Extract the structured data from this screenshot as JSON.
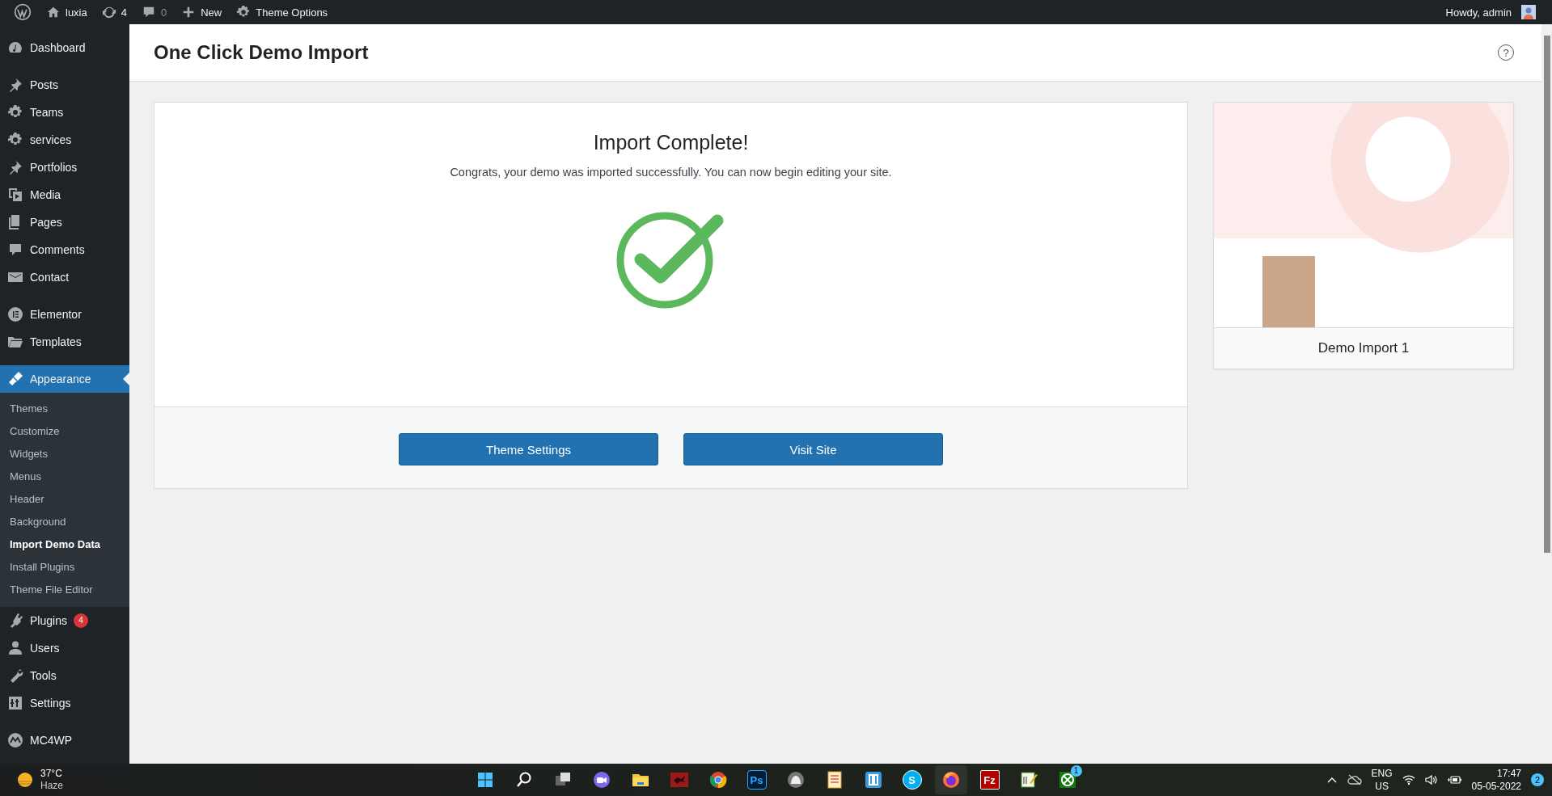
{
  "admin_bar": {
    "items": [
      {
        "kind": "wp-logo"
      },
      {
        "kind": "home",
        "label": "luxia"
      },
      {
        "kind": "updates",
        "label": "4"
      },
      {
        "kind": "comments",
        "label": "0",
        "disabled": true
      },
      {
        "kind": "new",
        "label": "New"
      },
      {
        "kind": "gear",
        "label": "Theme Options"
      }
    ],
    "greeting": "Howdy, admin"
  },
  "sidebar": {
    "items": [
      {
        "kind": "dashboard",
        "label": "Dashboard",
        "selected": false,
        "separator_after": true
      },
      {
        "kind": "pin",
        "label": "Posts",
        "selected": false
      },
      {
        "kind": "gear",
        "label": "Teams",
        "selected": false
      },
      {
        "kind": "gear",
        "label": "services",
        "selected": false
      },
      {
        "kind": "pin",
        "label": "Portfolios",
        "selected": false
      },
      {
        "kind": "media",
        "label": "Media",
        "selected": false
      },
      {
        "kind": "pages",
        "label": "Pages",
        "selected": false
      },
      {
        "kind": "comment",
        "label": "Comments",
        "selected": false
      },
      {
        "kind": "mail",
        "label": "Contact",
        "selected": false,
        "separator_after": true
      },
      {
        "kind": "elementor",
        "label": "Elementor",
        "selected": false
      },
      {
        "kind": "folder",
        "label": "Templates",
        "selected": false,
        "separator_after": true
      },
      {
        "kind": "brush",
        "label": "Appearance",
        "selected": true,
        "children": [
          {
            "label": "Themes",
            "selected": false
          },
          {
            "label": "Customize",
            "selected": false
          },
          {
            "label": "Widgets",
            "selected": false
          },
          {
            "label": "Menus",
            "selected": false
          },
          {
            "label": "Header",
            "selected": false
          },
          {
            "label": "Background",
            "selected": false
          },
          {
            "label": "Import Demo Data",
            "selected": true
          },
          {
            "label": "Install Plugins",
            "selected": false
          },
          {
            "label": "Theme File Editor",
            "selected": false
          }
        ]
      },
      {
        "kind": "plug",
        "label": "Plugins",
        "selected": false,
        "badge": "4"
      },
      {
        "kind": "user",
        "label": "Users",
        "selected": false
      },
      {
        "kind": "wrench",
        "label": "Tools",
        "selected": false
      },
      {
        "kind": "sliders",
        "label": "Settings",
        "selected": false,
        "separator_after": true
      },
      {
        "kind": "mc4wp",
        "label": "MC4WP",
        "selected": false
      }
    ]
  },
  "page": {
    "title": "One Click Demo Import",
    "help": "?",
    "import": {
      "heading": "Import Complete!",
      "message": "Congrats, your demo was imported successfully. You can now begin editing your site.",
      "buttons": [
        "Theme Settings",
        "Visit Site"
      ]
    },
    "demo": {
      "caption": "Demo Import 1"
    }
  },
  "taskbar": {
    "weather": {
      "temperature": "37°C",
      "condition": "Haze"
    },
    "apps": [
      {
        "kind": "start",
        "active": false
      },
      {
        "kind": "search",
        "active": false
      },
      {
        "kind": "taskview",
        "active": false
      },
      {
        "kind": "chat",
        "active": false
      },
      {
        "kind": "folder",
        "active": false
      },
      {
        "kind": "tile",
        "active": false
      },
      {
        "kind": "browser",
        "active": false
      },
      {
        "kind": "letter",
        "label": "Ps",
        "active": false
      },
      {
        "kind": "circle",
        "active": false
      },
      {
        "kind": "list",
        "active": false
      },
      {
        "kind": "bracket",
        "active": false
      },
      {
        "kind": "round-letter",
        "label": "S",
        "active": false
      },
      {
        "kind": "firefox",
        "active": true
      },
      {
        "kind": "letter-red",
        "label": "Fz",
        "active": false
      },
      {
        "kind": "notepad",
        "active": false
      },
      {
        "kind": "xbox",
        "badge": "1",
        "active": false
      }
    ],
    "tray": {
      "language": "ENG",
      "region": "US",
      "time": "17:47",
      "date": "05-05-2022",
      "notifications": "2"
    }
  }
}
